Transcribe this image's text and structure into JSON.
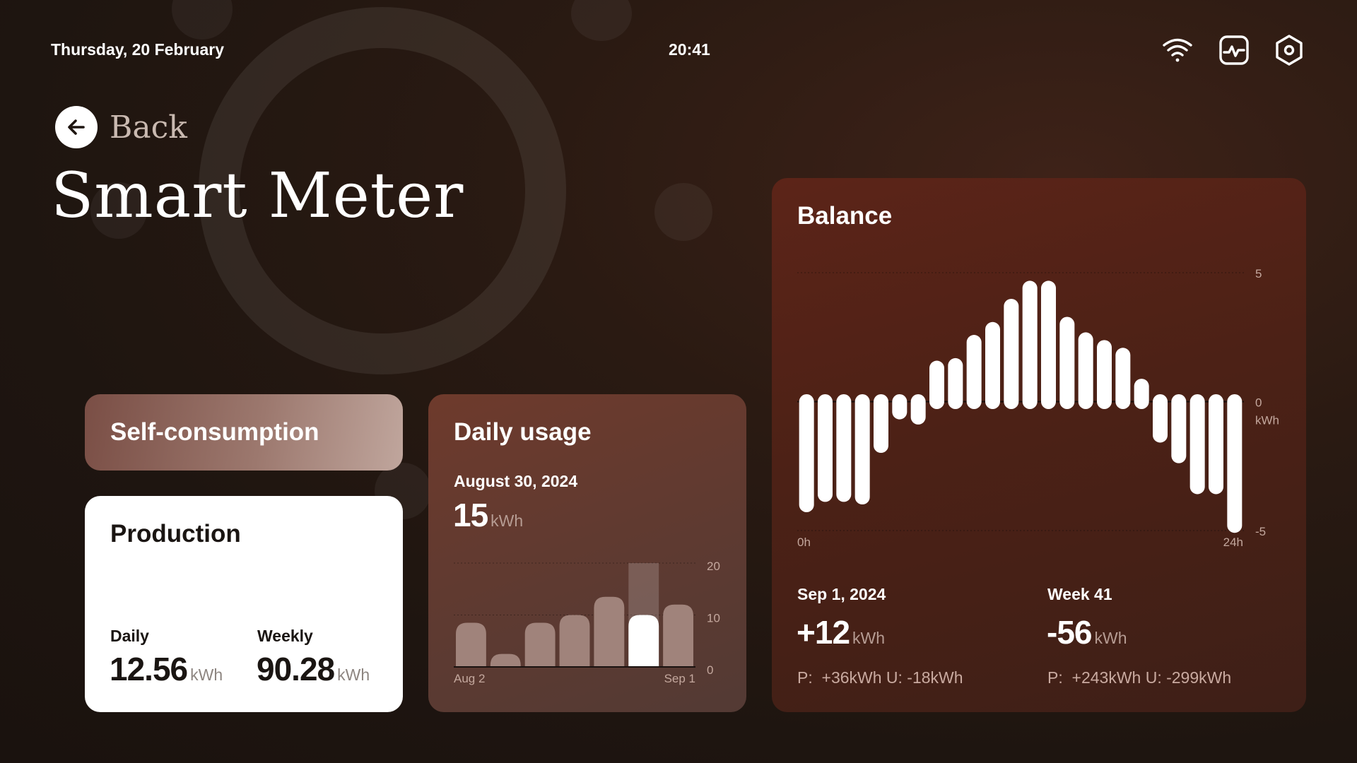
{
  "topbar": {
    "date": "Thursday, 20 February",
    "time": "20:41",
    "icons": [
      "wifi-icon",
      "activity-monitor-icon",
      "settings-hex-icon"
    ]
  },
  "nav": {
    "back_label": "Back"
  },
  "page": {
    "title": "Smart Meter"
  },
  "self_consumption": {
    "title": "Self-consumption"
  },
  "production": {
    "title": "Production",
    "daily_label": "Daily",
    "daily_value": "12.56",
    "weekly_label": "Weekly",
    "weekly_value": "90.28",
    "unit": "kWh"
  },
  "daily_usage": {
    "title": "Daily usage",
    "date": "August 30, 2024",
    "value": "15",
    "unit": "kWh"
  },
  "balance": {
    "title": "Balance",
    "day": {
      "label": "Sep 1, 2024",
      "value": "+12",
      "unit": "kWh",
      "breakdown": "P:  +36kWh U: -18kWh"
    },
    "week": {
      "label": "Week 41",
      "value": "-56",
      "unit": "kWh",
      "breakdown": "P:  +243kWh U: -299kWh"
    }
  },
  "colors": {
    "accent": "#5c2418",
    "bar_active": "#ffffff",
    "bar_inactive": "#a0837b"
  },
  "chart_data": [
    {
      "type": "bar",
      "name": "daily-usage",
      "x_labels": [
        "Aug 2",
        "Sep 1"
      ],
      "y_ticks": [
        "20",
        "10",
        "0"
      ],
      "ylim": [
        0,
        20
      ],
      "grid": true,
      "values": [
        8.5,
        2.5,
        8.5,
        10,
        13.5,
        10,
        12
      ],
      "highlight_index": 5,
      "highlight_background": true
    },
    {
      "type": "bar",
      "name": "balance",
      "x_labels": [
        "0h",
        "24h"
      ],
      "y_ticks": [
        "5",
        "0",
        "-5"
      ],
      "y_unit": "kWh",
      "ylim": [
        -5,
        5
      ],
      "grid": true,
      "values": [
        -4,
        -3.6,
        -3.6,
        -3.7,
        -1.7,
        -0.4,
        -0.6,
        1.3,
        1.4,
        2.3,
        2.8,
        3.7,
        4.4,
        4.4,
        3,
        2.4,
        2.1,
        1.8,
        0.6,
        -1.3,
        -2.1,
        -3.3,
        -3.3,
        -4.8
      ]
    }
  ]
}
